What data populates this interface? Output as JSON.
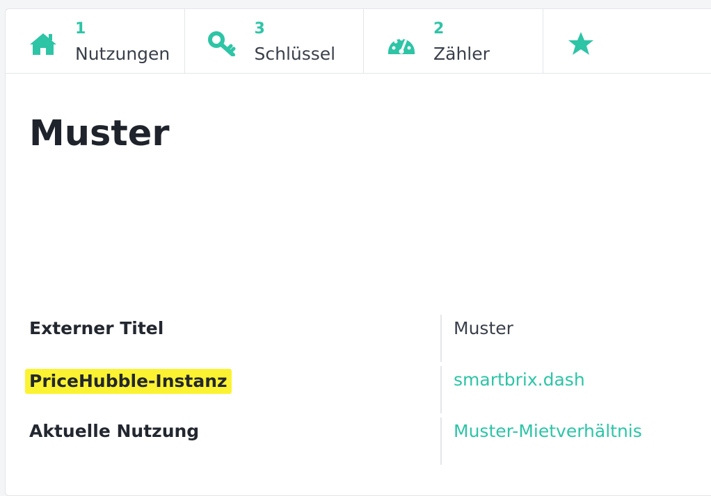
{
  "accent_color": "#2ec4a6",
  "highlight_color": "#fbf331",
  "tabs": [
    {
      "icon": "home-icon",
      "count": "1",
      "label": "Nutzungen"
    },
    {
      "icon": "key-icon",
      "count": "3",
      "label": "Schlüssel"
    },
    {
      "icon": "gauge-icon",
      "count": "2",
      "label": "Zähler"
    },
    {
      "icon": "star-icon",
      "count": "",
      "label": ""
    }
  ],
  "page": {
    "title": "Muster"
  },
  "properties": [
    {
      "label": "Externer Titel",
      "value": "Muster"
    },
    {
      "label": "PriceHubble-Instanz",
      "value": "smartbrix.dash"
    },
    {
      "label": "Aktuelle Nutzung",
      "value": "Muster-Mietverhältnis"
    }
  ]
}
